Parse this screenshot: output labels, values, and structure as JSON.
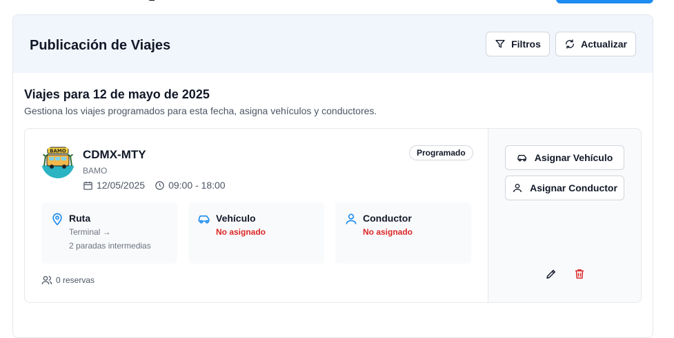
{
  "header": {
    "title": "Publicación de Viajes",
    "filters_label": "Filtros",
    "refresh_label": "Actualizar"
  },
  "section": {
    "title": "Viajes para 12 de mayo de 2025",
    "description": "Gestiona los viajes programados para esta fecha, asigna vehículos y conductores."
  },
  "trip": {
    "route": "CDMX-MTY",
    "company": "BAMO",
    "date": "12/05/2025",
    "time": "09:00 - 18:00",
    "status": "Programado",
    "ruta_title": "Ruta",
    "ruta_line1": "Terminal →",
    "ruta_line2": "2 paradas intermedias",
    "vehiculo_title": "Vehículo",
    "vehiculo_value": "No asignado",
    "conductor_title": "Conductor",
    "conductor_value": "No asignado",
    "reservas": "0 reservas",
    "assign_vehicle_label": "Asignar Vehículo",
    "assign_driver_label": "Asignar Conductor",
    "logo_text": "BAMO"
  },
  "colors": {
    "accent": "#1d8cf0",
    "warning": "#dc2626",
    "header_bg": "#f0f6fc"
  }
}
